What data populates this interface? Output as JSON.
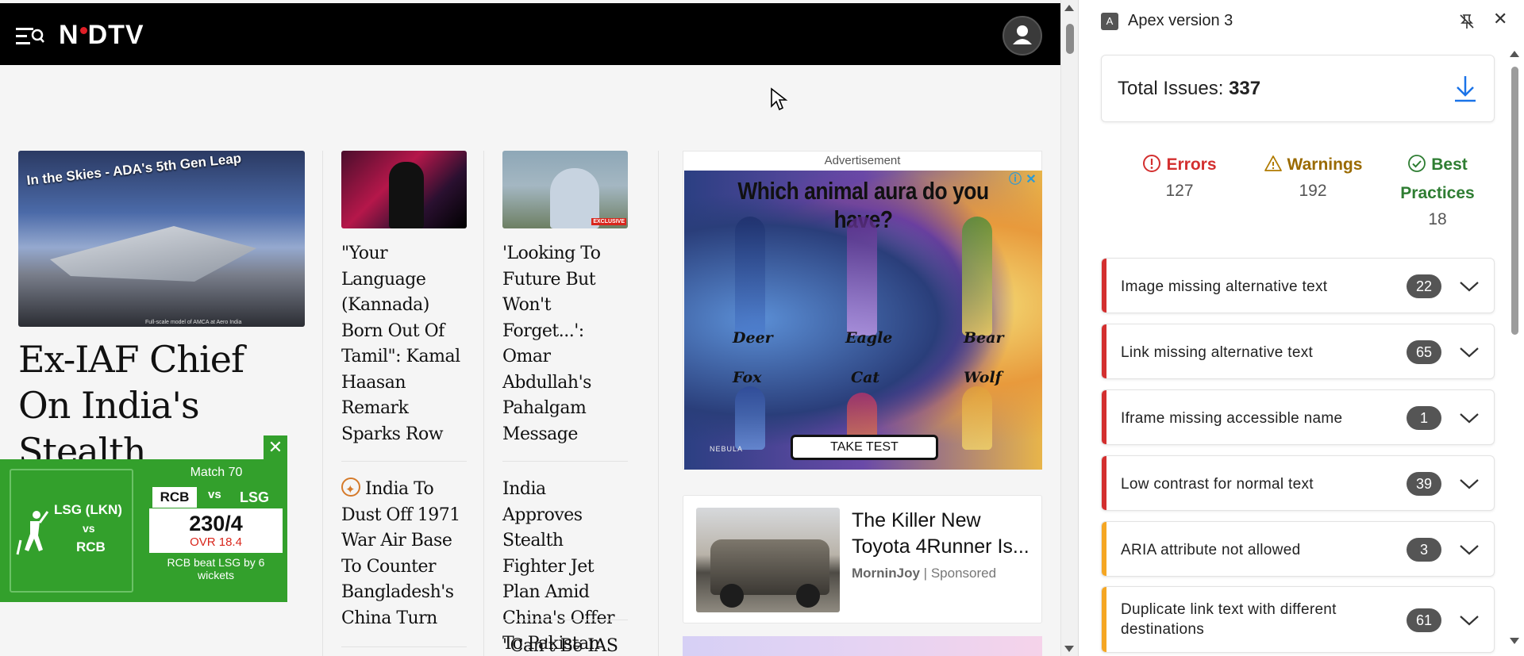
{
  "site": {
    "logo": "NDTV",
    "hero": {
      "image_banner": "In the Skies - ADA's 5th Gen Leap",
      "image_caption": "Full-scale model of AMCA at Aero India",
      "title": "Ex-IAF Chief On India's Stealth Fighter Jet Plan"
    },
    "cricket": {
      "team_a": "LSG (LKN)",
      "vs": "vs",
      "team_b": "RCB",
      "match": "Match 70",
      "pill_a": "RCB",
      "vs_b": "vs",
      "pill_b": "LSG",
      "score": "230/4",
      "overs": "OVR 18.4",
      "result": "RCB beat LSG by 6 wickets"
    },
    "col2": {
      "story_a": "\"Your Language (Kannada) Born Out Of Tamil\": Kamal Haasan Remark Sparks Row",
      "story_b": "India To Dust Off 1971 War Air Base To Counter Bangladesh's China Turn"
    },
    "col3": {
      "image_tag": "EXCLUSIVE",
      "story_a": "'Looking To Future But Won't Forget...': Omar Abdullah's Pahalgam Message",
      "story_b": "India Approves Stealth Fighter Jet Plan Amid China's Offer To Pakistan",
      "story_c": "\"Can't Be IAS"
    },
    "ad1": {
      "label": "Advertisement",
      "headline": "Which animal aura do you have?",
      "labels": [
        "Deer",
        "Eagle",
        "Bear",
        "Fox",
        "Cat",
        "Wolf"
      ],
      "brand": "NEBULA",
      "cta": "TAKE TEST"
    },
    "ad2": {
      "title": "The Killer New Toyota 4Runner Is...",
      "source": "MorninJoy",
      "sponsored": "Sponsored"
    }
  },
  "panel": {
    "title": "Apex version 3",
    "ext_icon": "A",
    "total_label": "Total Issues: ",
    "total_value": "337",
    "stats": {
      "errors_label": "Errors",
      "errors_value": "127",
      "warnings_label": "Warnings",
      "warnings_value": "192",
      "best_label_1": "Best",
      "best_label_2": "Practices",
      "best_value": "18"
    },
    "issues": [
      {
        "label": "Image missing alternative text",
        "count": "22",
        "severity": "error"
      },
      {
        "label": "Link missing alternative text",
        "count": "65",
        "severity": "error"
      },
      {
        "label": "Iframe missing accessible name",
        "count": "1",
        "severity": "error"
      },
      {
        "label": "Low contrast for normal text",
        "count": "39",
        "severity": "error"
      },
      {
        "label": "ARIA attribute not allowed",
        "count": "3",
        "severity": "warning"
      },
      {
        "label": "Duplicate link text with different destinations",
        "count": "61",
        "severity": "warning"
      }
    ]
  },
  "colors": {
    "error": "#d32f2f",
    "warning": "#f5a623",
    "warning_text": "#9a6a00",
    "best": "#2e7d32",
    "accent": "#1a73e8",
    "cricket_green": "#33a02c",
    "logo_dot": "#e01e26"
  },
  "icons": {
    "site": [
      "menu-search-icon",
      "account-icon",
      "close-icon",
      "cricket-bat-icon",
      "star-icon",
      "adchoices-icon"
    ],
    "panel": [
      "extension-icon",
      "unpin-icon",
      "close-icon",
      "download-icon",
      "error-icon",
      "warning-icon",
      "check-circle-icon",
      "chevron-down-icon"
    ]
  }
}
